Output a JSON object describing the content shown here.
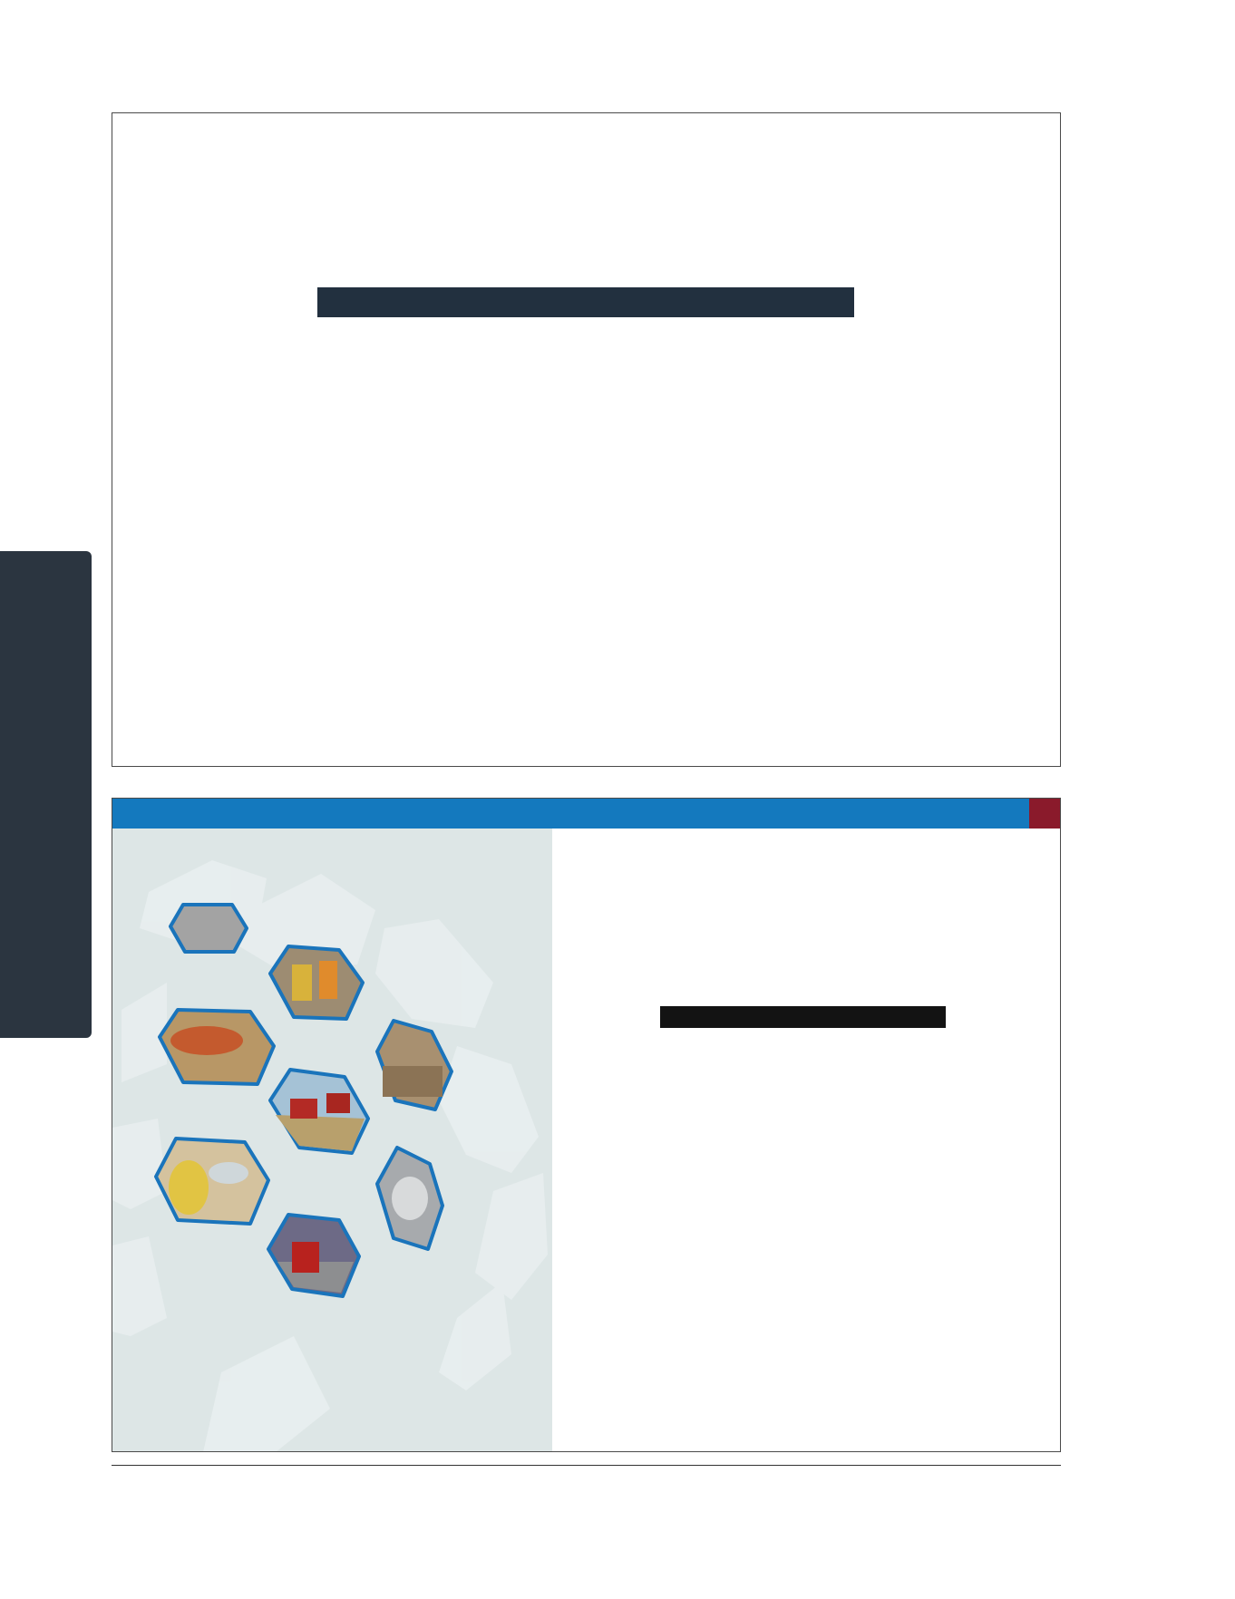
{
  "colors": {
    "side_tab": "#2b3540",
    "title_bar_top": "#22303f",
    "header_blue": "#1479be",
    "header_red": "#8a1a2b",
    "panel_bg": "#dde6e6",
    "panel_hex_light": "#e9eff0",
    "hex_border": "#1a74bb",
    "title_bar_bottom": "#131313"
  },
  "top_slide": {
    "title_redacted": true
  },
  "bottom_slide": {
    "title_redacted": true,
    "photos": [
      "handshake-photo",
      "road-workers-photo",
      "food-platter-photo",
      "construction-site-photo",
      "combine-harvester-photo",
      "safety-gear-photo",
      "metal-part-photo",
      "truck-photo"
    ]
  }
}
